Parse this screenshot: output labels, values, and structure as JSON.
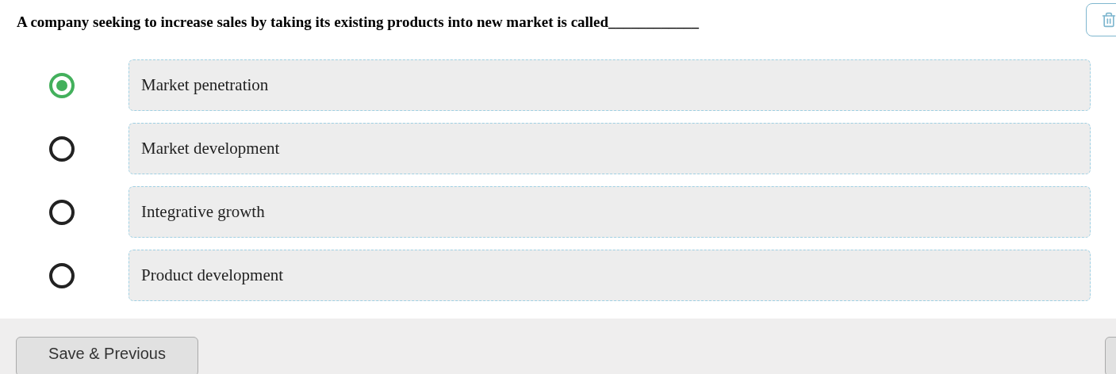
{
  "question": "A company seeking to increase sales by taking its existing products into new market is called____________",
  "options": [
    {
      "label": "Market penetration",
      "selected": true
    },
    {
      "label": "Market development",
      "selected": false
    },
    {
      "label": "Integrative growth",
      "selected": false
    },
    {
      "label": "Product development",
      "selected": false
    }
  ],
  "footer": {
    "buttons": [
      "Save & Previous"
    ]
  }
}
